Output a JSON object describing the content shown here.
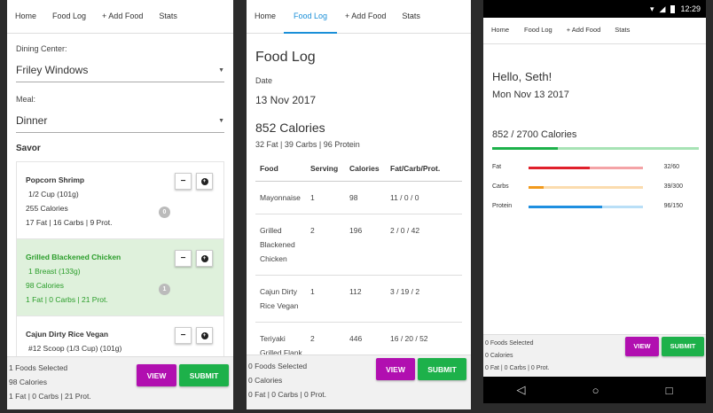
{
  "panel1": {
    "nav": [
      "Home",
      "Food Log",
      "+ Add Food",
      "Stats"
    ],
    "dining_label": "Dining Center:",
    "dining_value": "Friley Windows",
    "meal_label": "Meal:",
    "meal_value": "Dinner",
    "section": "Savor",
    "items": [
      {
        "name": "Popcorn Shrimp",
        "serving": "1/2 Cup (101g)",
        "calories": "255 Calories",
        "macros": "17 Fat | 16 Carbs | 9 Prot.",
        "count": "0"
      },
      {
        "name": "Grilled Blackened Chicken",
        "serving": "1 Breast (133g)",
        "calories": "98 Calories",
        "macros": "1 Fat | 0 Carbs | 21 Prot.",
        "count": "1"
      },
      {
        "name": "Cajun Dirty Rice Vegan",
        "serving": "#12 Scoop (1/3 Cup) (101g)",
        "calories": "",
        "macros": "",
        "count": ""
      }
    ],
    "minus_label": "−",
    "plus_label": "+",
    "footer": {
      "selected": "1 Foods Selected",
      "calories": "98 Calories",
      "macros": "1 Fat | 0 Carbs | 21 Prot."
    },
    "view_label": "VIEW",
    "submit_label": "SUBMIT"
  },
  "panel2": {
    "nav": [
      "Home",
      "Food Log",
      "+ Add Food",
      "Stats"
    ],
    "title": "Food Log",
    "date_label": "Date",
    "date_value": "13 Nov 2017",
    "calories": "852 Calories",
    "macros": "32 Fat | 39 Carbs | 96 Protein",
    "columns": [
      "Food",
      "Serving",
      "Calories",
      "Fat/Carb/Prot."
    ],
    "rows": [
      [
        "Mayonnaise",
        "1",
        "98",
        "11 / 0 / 0"
      ],
      [
        "Grilled Blackened Chicken",
        "2",
        "196",
        "2 / 0 / 42"
      ],
      [
        "Cajun Dirty Rice Vegan",
        "1",
        "112",
        "3 / 19 / 2"
      ],
      [
        "Teriyaki Grilled Flank Steak",
        "2",
        "446",
        "16 / 20 / 52"
      ]
    ],
    "footer": {
      "selected": "0 Foods Selected",
      "calories": "0 Calories",
      "macros": "0 Fat | 0 Carbs | 0 Prot."
    },
    "view_label": "VIEW",
    "submit_label": "SUBMIT"
  },
  "panel3": {
    "status_time": "12:29",
    "nav": [
      "Home",
      "Food Log",
      "+ Add Food",
      "Stats"
    ],
    "greeting": "Hello, Seth!",
    "date": "Mon Nov 13 2017",
    "calories": "852 / 2700 Calories",
    "calorie_fraction": 0.3156,
    "macros": [
      {
        "label": "Fat",
        "value": "32/60",
        "fraction": 0.533,
        "color": "#e0202b",
        "track": "#f4a3a6"
      },
      {
        "label": "Carbs",
        "value": "39/300",
        "fraction": 0.13,
        "color": "#f29a1d",
        "track": "#fbdcae"
      },
      {
        "label": "Protein",
        "value": "96/150",
        "fraction": 0.64,
        "color": "#1f8fe0",
        "track": "#b9dff7"
      }
    ],
    "footer": {
      "selected": "0 Foods Selected",
      "calories": "0 Calories",
      "macros": "0 Fat | 0 Carbs | 0 Prot."
    },
    "view_label": "VIEW",
    "submit_label": "SUBMIT",
    "colors": {
      "calorie_bar": "#1db14a",
      "calorie_track": "#a7e3b5"
    }
  }
}
